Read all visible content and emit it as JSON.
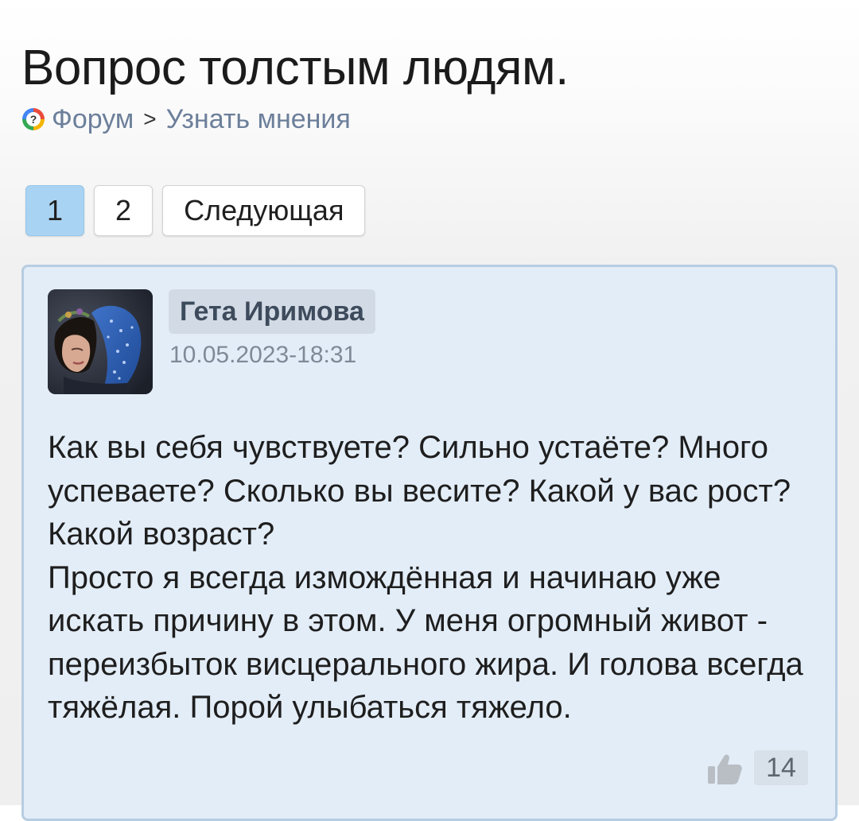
{
  "page": {
    "title": "Вопрос толстым людям."
  },
  "breadcrumb": {
    "icon": "forum-question-icon",
    "items": [
      "Форум",
      "Узнать мнения"
    ],
    "separator": ">"
  },
  "pagination": {
    "pages": [
      "1",
      "2"
    ],
    "current": "1",
    "next_label": "Следующая"
  },
  "post": {
    "author": "Гета Иримова",
    "timestamp": "10.05.2023-18:31",
    "text": "Как вы себя чувствуете? Сильно устаёте? Много успеваете? Сколько вы весите? Какой у вас рост? Какой возраст?\nПросто я всегда измождённая и начинаю уже искать причину в этом. У меня огромный живот - переизбыток висцерального жира. И голова всегда тяжёлая. Порой улыбаться тяжело.",
    "likes": "14",
    "like_icon": "thumbs-up-icon",
    "avatar": "user-avatar-photo"
  },
  "colors": {
    "link": "#6c7f9a",
    "active_page": "#a9d3f2",
    "post_background": "#e3edf8",
    "post_border": "#b6cde2",
    "author_badge": "#d2dbe5"
  }
}
